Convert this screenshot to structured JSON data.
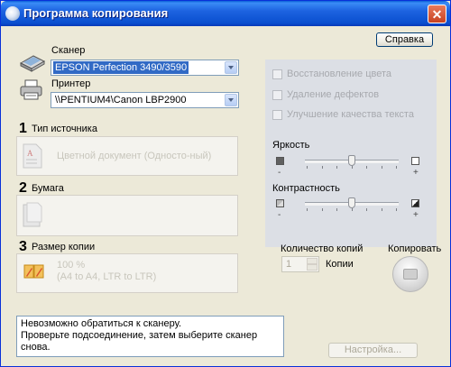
{
  "window": {
    "title": "Программа копирования",
    "close_label": "✕"
  },
  "help_button": "Справка",
  "scanner": {
    "label": "Сканер",
    "selected": "EPSON Perfection 3490/3590"
  },
  "printer": {
    "label": "Принтер",
    "selected": "\\\\PENTIUM4\\Canon LBP2900"
  },
  "source_type": {
    "number": "1",
    "label": "Тип источника",
    "value": "Цветной документ (Односто-ный)"
  },
  "paper": {
    "number": "2",
    "label": "Бумага"
  },
  "copy_size": {
    "number": "3",
    "label": "Размер копии",
    "line1": "100 %",
    "line2": "(A4 to A4, LTR to LTR)"
  },
  "options": {
    "color_restore": "Восстановление цвета",
    "defect_removal": "Удаление дефектов",
    "text_enhance": "Улучшение качества текста"
  },
  "brightness": {
    "label": "Яркость",
    "minus": "-",
    "plus": "+",
    "level": 0.5
  },
  "contrast": {
    "label": "Контрастность",
    "minus": "-",
    "plus": "+",
    "level": 0.5
  },
  "copies": {
    "label": "Количество копий",
    "value": "1",
    "unit": "Копии"
  },
  "copy_button": "Копировать",
  "status": {
    "line1": "Невозможно обратиться к сканеру.",
    "line2": "Проверьте подсоединение, затем выберите сканер снова."
  },
  "settings_button": "Настройка..."
}
